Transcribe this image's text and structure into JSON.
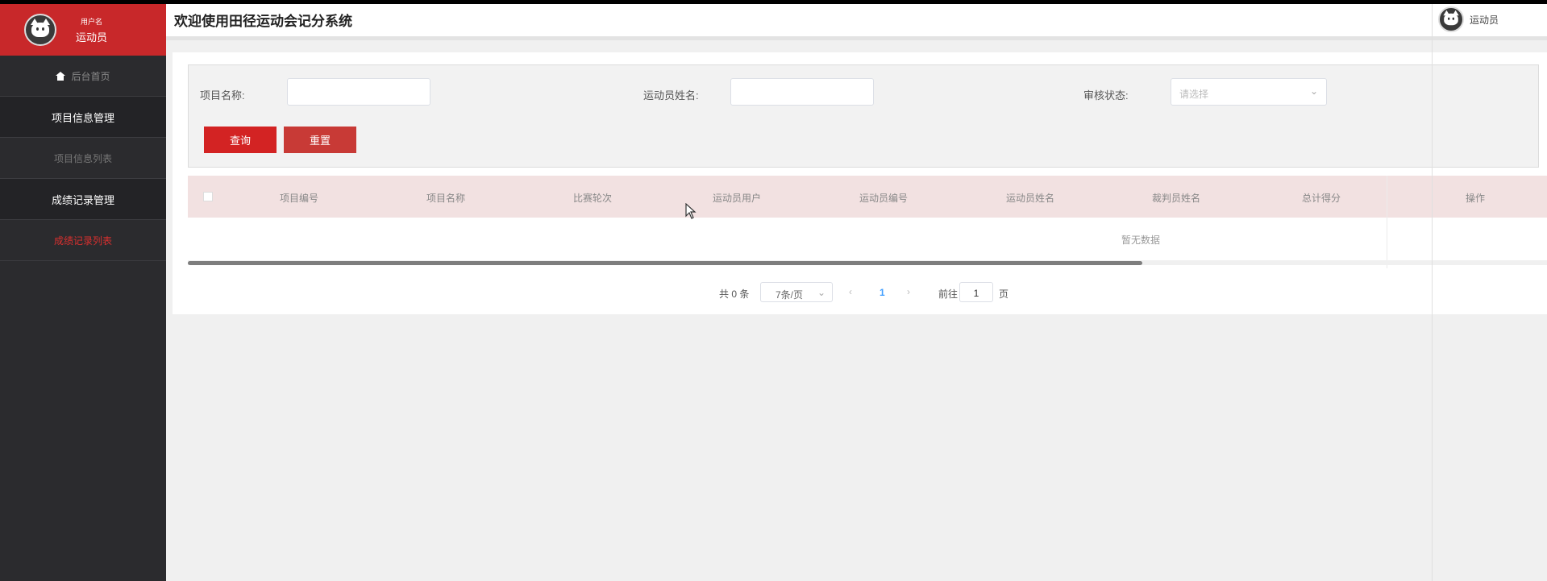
{
  "app": {
    "title": "欢迎使用田径运动会记分系统"
  },
  "sidebar": {
    "profile": {
      "sub_label": "用户名",
      "name": "运动员"
    },
    "home_label": "后台首页",
    "groups": [
      {
        "label": "项目信息管理",
        "items": [
          {
            "label": "项目信息列表",
            "active": false
          }
        ]
      },
      {
        "label": "成绩记录管理",
        "items": [
          {
            "label": "成绩记录列表",
            "active": true
          }
        ]
      }
    ]
  },
  "header": {
    "user_name": "运动员"
  },
  "filter": {
    "project_name_label": "项目名称:",
    "project_name_value": "",
    "athlete_name_label": "运动员姓名:",
    "athlete_name_value": "",
    "status_label": "审核状态:",
    "status_placeholder": "请选择",
    "query_button": "查询",
    "reset_button": "重置"
  },
  "table": {
    "columns": [
      "项目编号",
      "项目名称",
      "比赛轮次",
      "运动员用户",
      "运动员编号",
      "运动员姓名",
      "裁判员姓名",
      "总计得分",
      "操作"
    ],
    "rows": [],
    "empty_text": "暂无数据"
  },
  "pagination": {
    "total_text": "共 0 条",
    "page_size": "7条/页",
    "current_page": "1",
    "goto_label": "前往",
    "goto_value": "1",
    "page_suffix": "页"
  },
  "colors": {
    "brand_red": "#c8282a",
    "sidebar_bg": "#2b2b2e",
    "active_link": "#d9302f",
    "table_header_bg": "#f2e1e1"
  }
}
